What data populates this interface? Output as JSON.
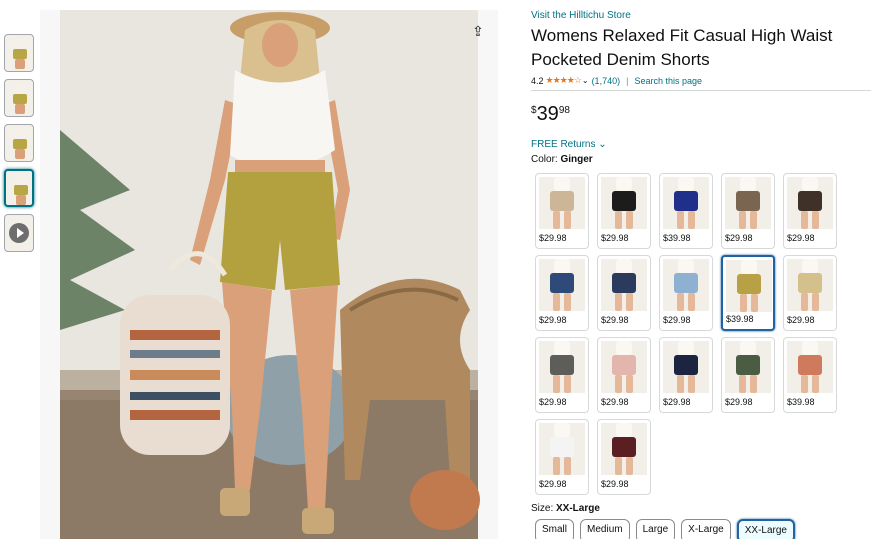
{
  "thumbnails": [
    "image-1",
    "image-2",
    "image-3",
    "image-4",
    "video"
  ],
  "product": {
    "store_link": "Visit the Hilltichu Store",
    "title": "Womens Relaxed Fit Casual High Waist Pocketed Denim Shorts",
    "rating": "4.2",
    "stars": "★★★★☆",
    "review_count": "(1,740)",
    "separator": "|",
    "search_page": "Search this page",
    "price_symbol": "$",
    "price_whole": "39",
    "price_fraction": "98",
    "returns": "FREE Returns",
    "color_label": "Color:",
    "color_value": "Ginger",
    "size_label": "Size:",
    "size_value": "XX-Large"
  },
  "colors": [
    {
      "price": "$29.98",
      "color": "#cdb697"
    },
    {
      "price": "$29.98",
      "color": "#1c1c1c"
    },
    {
      "price": "$39.98",
      "color": "#1f2f8a"
    },
    {
      "price": "$29.98",
      "color": "#7a6550"
    },
    {
      "price": "$29.98",
      "color": "#3f3128"
    },
    {
      "price": "$29.98",
      "color": "#2d4a78"
    },
    {
      "price": "$29.98",
      "color": "#2a3b5e"
    },
    {
      "price": "$29.98",
      "color": "#8fb1d1"
    },
    {
      "price": "$39.98",
      "color": "#b8a044"
    },
    {
      "price": "$29.98",
      "color": "#d3c08b"
    },
    {
      "price": "$29.98",
      "color": "#5d5d5a"
    },
    {
      "price": "$29.98",
      "color": "#e2b6ad"
    },
    {
      "price": "$29.98",
      "color": "#1b2541"
    },
    {
      "price": "$29.98",
      "color": "#4a5d43"
    },
    {
      "price": "$39.98",
      "color": "#cf7a5c"
    },
    {
      "price": "$29.98",
      "color": "#f4f4f4"
    },
    {
      "price": "$29.98",
      "color": "#5b1e23"
    }
  ],
  "selected_color_index": 8,
  "sizes": [
    "Small",
    "Medium",
    "Large",
    "X-Large",
    "XX-Large"
  ],
  "selected_size_index": 4,
  "accent_colors": {
    "link": "#007185",
    "star": "#de7921",
    "selected": "#2162a1"
  }
}
